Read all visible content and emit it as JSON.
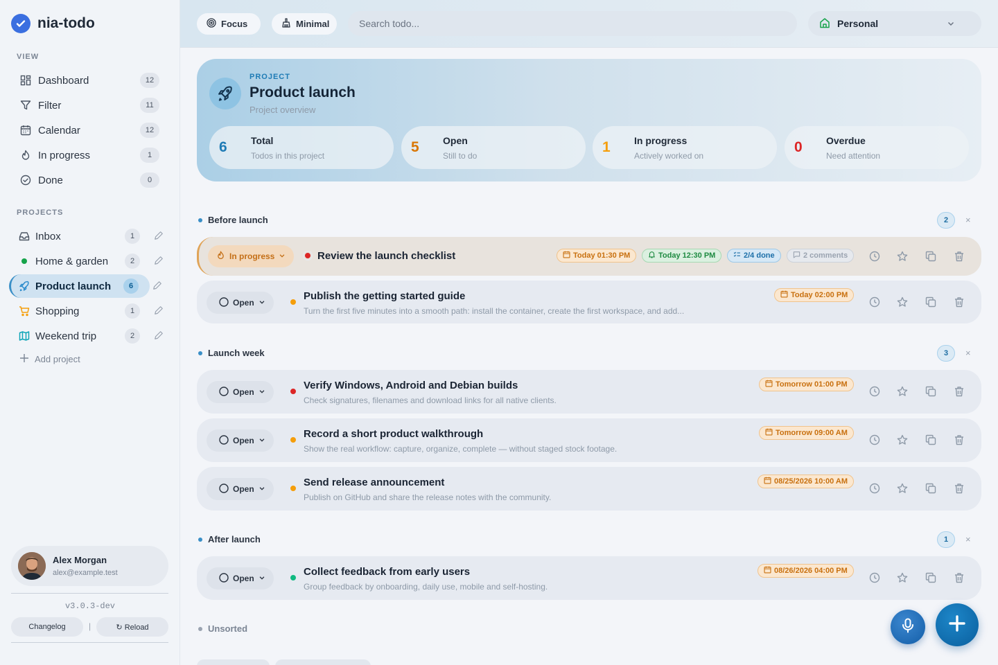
{
  "app": {
    "name": "nia-todo",
    "logo_icon": "check-circle-icon",
    "brand_color": "#3b6fe0"
  },
  "sidebar": {
    "view_heading": "VIEW",
    "view_items": [
      {
        "label": "Dashboard",
        "count": "12",
        "icon": "dashboard-icon"
      },
      {
        "label": "Filter",
        "count": "11",
        "icon": "filter-icon"
      },
      {
        "label": "Calendar",
        "count": "12",
        "icon": "calendar-icon"
      },
      {
        "label": "In progress",
        "count": "1",
        "icon": "flame-icon"
      },
      {
        "label": "Done",
        "count": "0",
        "icon": "check-circle-icon"
      }
    ],
    "projects_heading": "PROJECTS",
    "projects": [
      {
        "label": "Inbox",
        "count": "1",
        "icon": "inbox-icon"
      },
      {
        "label": "Home & garden",
        "count": "2",
        "icon": "green-dot-icon",
        "color": "#16a34a"
      },
      {
        "label": "Product launch",
        "count": "6",
        "icon": "rocket-icon",
        "active": true
      },
      {
        "label": "Shopping",
        "count": "1",
        "icon": "cart-icon",
        "color": "#f59e0b"
      },
      {
        "label": "Weekend trip",
        "count": "2",
        "icon": "map-icon",
        "color": "#0ea5b7"
      }
    ],
    "add_project": "Add project",
    "user": {
      "name": "Alex Morgan",
      "email": "alex@example.test"
    },
    "version": "v3.0.3-dev",
    "changelog": "Changelog",
    "separator": "|",
    "reload": "↻ Reload"
  },
  "topbar": {
    "focus": "Focus",
    "minimal": "Minimal",
    "search_placeholder": "Search todo...",
    "workspace": "Personal"
  },
  "project": {
    "kicker": "PROJECT",
    "title": "Product launch",
    "subtitle": "Project overview",
    "stats": [
      {
        "value": "6",
        "label": "Total",
        "desc": "Todos in this project",
        "color": "#1e7bb5"
      },
      {
        "value": "5",
        "label": "Open",
        "desc": "Still to do",
        "color": "#d97706"
      },
      {
        "value": "1",
        "label": "In progress",
        "desc": "Actively worked on",
        "color": "#f59e0b"
      },
      {
        "value": "0",
        "label": "Overdue",
        "desc": "Need attention",
        "color": "#dc2626"
      }
    ]
  },
  "groups": [
    {
      "name": "Before launch",
      "count": "2"
    },
    {
      "name": "Launch week",
      "count": "3"
    },
    {
      "name": "After launch",
      "count": "1"
    },
    {
      "name": "Unsorted"
    }
  ],
  "close_glyph": "×",
  "todos": [
    {
      "status": "In progress",
      "title": "Review the launch checklist",
      "desc": "",
      "priority_color": "#dc2626",
      "chips": {
        "date": "Today 01:30 PM",
        "reminder": "Today 12:30 PM",
        "subtasks": "2/4 done",
        "comments": "2 comments"
      }
    },
    {
      "status": "Open",
      "title": "Publish the getting started guide",
      "desc": "Turn the first five minutes into a smooth path: install the container, create the first workspace, and add...",
      "priority_color": "#f59e0b",
      "chips": {
        "date": "Today 02:00 PM"
      }
    },
    {
      "status": "Open",
      "title": "Verify Windows, Android and Debian builds",
      "desc": "Check signatures, filenames and download links for all native clients.",
      "priority_color": "#dc2626",
      "chips": {
        "date": "Tomorrow 01:00 PM"
      }
    },
    {
      "status": "Open",
      "title": "Record a short product walkthrough",
      "desc": "Show the real workflow: capture, organize, complete — without staged stock footage.",
      "priority_color": "#f59e0b",
      "chips": {
        "date": "Tomorrow 09:00 AM"
      }
    },
    {
      "status": "Open",
      "title": "Send release announcement",
      "desc": "Publish on GitHub and share the release notes with the community.",
      "priority_color": "#f59e0b",
      "chips": {
        "date": "08/25/2026 10:00 AM"
      }
    },
    {
      "status": "Open",
      "title": "Collect feedback from early users",
      "desc": "Group feedback by onboarding, daily use, mobile and self-hosting.",
      "priority_color": "#10b981",
      "chips": {
        "date": "08/26/2026 04:00 PM"
      }
    }
  ],
  "fab": {
    "mic_icon": "microphone-icon",
    "add_icon": "plus-icon"
  }
}
